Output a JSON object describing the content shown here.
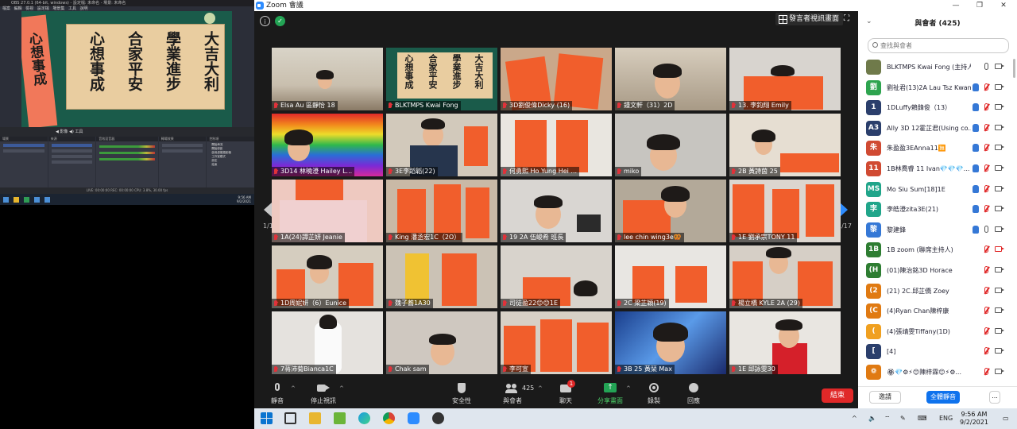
{
  "obs": {
    "title": "OBS 27.0.1 (64-bit, windows) - 設定檔: 未命名 - 場景: 未命名",
    "menu": "檔案 編輯 檢視 設定檔 場景集 工具 說明",
    "calligraphy": [
      "大吉大利",
      "學業進步",
      "合家平安",
      "心想事成"
    ],
    "side_banner": "心想事成",
    "toolbar_text": "◀ 影像    ◀) 工具",
    "docks": [
      "場景",
      "來源",
      "音效混音器",
      "轉場效果",
      "控制項"
    ],
    "controls": [
      "開始串流",
      "開始錄影",
      "啟用虛擬攝影機",
      "工作室模式",
      "設定",
      "結束"
    ],
    "status": "LIVE: 00:00:00   REC: 00:00:00   CPU: 3.8%, 30.00 fps",
    "clock": [
      "9:56 AM",
      "9/2/2021"
    ]
  },
  "zoom": {
    "title": "Zoom 會議",
    "view_button": "發言者視訊畫面",
    "page_left": "1/17",
    "page_right": "1/17",
    "tiles": [
      {
        "name": "Elsa Au 區靜怡 18"
      },
      {
        "name": "BLKTMPS Kwai Fong"
      },
      {
        "name": "3D劉俊偉Dicky (16)"
      },
      {
        "name": "鍾文軒（31）2D"
      },
      {
        "name": "13. 李鈞翔 Emily"
      },
      {
        "name": "3D14 林曉澄 Hailey L..."
      },
      {
        "name": "3E李蹈韜(22)"
      },
      {
        "name": "何勇熙 Ho Yung Hei ..."
      },
      {
        "name": "miko"
      },
      {
        "name": "2B 黃詩茵 25"
      },
      {
        "name": "1A(24)譚芷妍 Jeanie"
      },
      {
        "name": "King 潘丞宏1C（2O）"
      },
      {
        "name": "19 2A 伍峻希 班長"
      },
      {
        "name": "lee chin wing3e🥨"
      },
      {
        "name": "1E 劉承宗TONY 11"
      },
      {
        "name": "1D周妮妍（6）Eunice"
      },
      {
        "name": "魏子蕎1A30"
      },
      {
        "name": "司徒盈22😊😊1E"
      },
      {
        "name": "2C  梁芷穎(19)"
      },
      {
        "name": "楊立橋 KYLE 2A (29)"
      },
      {
        "name": "7蒋沛菊Bianca1C"
      },
      {
        "name": "Chak sam"
      },
      {
        "name": "李可宣"
      },
      {
        "name": "3B 25 黃琹 Max"
      },
      {
        "name": "1E 邱詠雯30"
      }
    ],
    "toolbar": {
      "mute": "靜音",
      "stop_video": "停止視訊",
      "security": "安全性",
      "participants": "與會者",
      "participants_count": "425",
      "chat": "聊天",
      "chat_badge": "1",
      "share": "分享畫面",
      "record": "錄製",
      "reactions": "回應",
      "end": "結束"
    }
  },
  "participants_panel": {
    "title": "與會者 (425)",
    "search_placeholder": "查找與會者",
    "invite": "邀請",
    "mute_all": "全體靜音",
    "more": "...",
    "items": [
      {
        "avatar": "",
        "color": "#6f7a4a",
        "name": "BLKTMPS Kwai Fong (主持人, 我)",
        "hand": false,
        "mic": "on",
        "cam": "on"
      },
      {
        "avatar": "劉",
        "color": "#2ea44f",
        "name": "劉祉君(13)2A Lau Tsz Kwan...",
        "hand": true,
        "mic": "muted",
        "cam": "on"
      },
      {
        "avatar": "1",
        "color": "#2b3f6c",
        "name": "1DLuffy賴鋒俊（13）",
        "hand": true,
        "mic": "muted",
        "cam": "on"
      },
      {
        "avatar": "A3",
        "color": "#2b3f6c",
        "name": "Ally 3D 12霍芷君(Using co...",
        "hand": true,
        "mic": "muted",
        "cam": "on"
      },
      {
        "avatar": "朱",
        "color": "#d04a32",
        "name": "朱盈盈3EAnna11🈚",
        "hand": true,
        "mic": "muted",
        "cam": "on"
      },
      {
        "avatar": "11",
        "color": "#d04a32",
        "name": "1B林喬睿 11 Ivan💎💎💎...",
        "hand": true,
        "mic": "muted",
        "cam": "on"
      },
      {
        "avatar": "MS",
        "color": "#20a58a",
        "name": "Mo Siu Sum[18]1E",
        "hand": true,
        "mic": "muted",
        "cam": "on"
      },
      {
        "avatar": "李",
        "color": "#20a58a",
        "name": "李皓澄zita3E(21)",
        "hand": true,
        "mic": "muted",
        "cam": "on"
      },
      {
        "avatar": "黎",
        "color": "#3578d6",
        "name": "黎建鋒",
        "hand": true,
        "mic": "on",
        "cam": "on"
      },
      {
        "avatar": "1B",
        "color": "#2e7d32",
        "name": "1B zoom (聯席主持人)",
        "hand": false,
        "mic": "muted",
        "cam": "muted"
      },
      {
        "avatar": "(H",
        "color": "#2e7d32",
        "name": "(01)陳治銘3D Horace",
        "hand": false,
        "mic": "muted",
        "cam": "on"
      },
      {
        "avatar": "(2",
        "color": "#e07a12",
        "name": "(21) 2C.邱芷僑 Zoey",
        "hand": false,
        "mic": "muted",
        "cam": "on"
      },
      {
        "avatar": "(C",
        "color": "#e07a12",
        "name": "(4)Ryan Chan陳梓康",
        "hand": false,
        "mic": "muted",
        "cam": "on"
      },
      {
        "avatar": "(",
        "color": "#f0a020",
        "name": "(4)張靖雯Tiffany(1D)",
        "hand": false,
        "mic": "muted",
        "cam": "on"
      },
      {
        "avatar": "[",
        "color": "#2b3f6c",
        "name": "[4]",
        "hand": false,
        "mic": "muted",
        "cam": "on"
      },
      {
        "avatar": "❁",
        "color": "#e07a12",
        "name": "🏵💎⚙⚡😊陳梓霖😊⚡⚙...",
        "hand": false,
        "mic": "muted",
        "cam": "on"
      }
    ]
  },
  "taskbar": {
    "lang": "ENG",
    "time": "9:56 AM",
    "date": "9/2/2021"
  }
}
